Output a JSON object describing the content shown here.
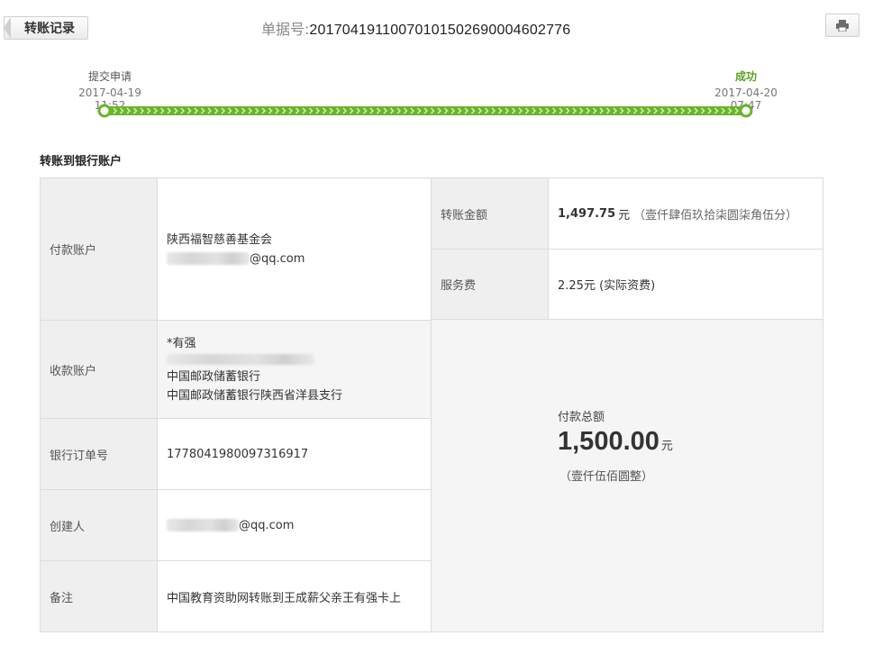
{
  "header": {
    "back_label": "转账记录",
    "doc_label": "单据号:",
    "doc_number": "20170419110070101502690004602776"
  },
  "timeline": {
    "start": {
      "label": "提交申请",
      "time": "2017-04-19 11:52"
    },
    "end": {
      "label": "成功",
      "time": "2017-04-20 07:47"
    },
    "progress": 1.0,
    "color": "#6ab42d"
  },
  "section_title": "转账到银行账户",
  "rows": {
    "payer": {
      "label": "付款账户",
      "name": "陕西福智慈善基金会",
      "email_suffix": "@qq.com"
    },
    "payee": {
      "label": "收款账户",
      "name": "*有强",
      "bank": "中国邮政储蓄银行",
      "branch": "中国邮政储蓄银行陕西省洋县支行"
    },
    "order": {
      "label": "银行订单号",
      "value": "1778041980097316917"
    },
    "creator": {
      "label": "创建人",
      "email_suffix": "@qq.com"
    },
    "note": {
      "label": "备注",
      "value": "中国教育资助网转账到王成薪父亲王有强卡上"
    },
    "amount": {
      "label": "转账金额",
      "value": "1,497.75",
      "unit": "元",
      "words": "（壹仟肆佰玖拾柒圆柒角伍分）"
    },
    "fee": {
      "label": "服务费",
      "value": "2.25元 (实际资费)"
    }
  },
  "total": {
    "label": "付款总额",
    "value": "1,500.00",
    "unit": "元",
    "words": "（壹仟伍佰圆整）"
  }
}
